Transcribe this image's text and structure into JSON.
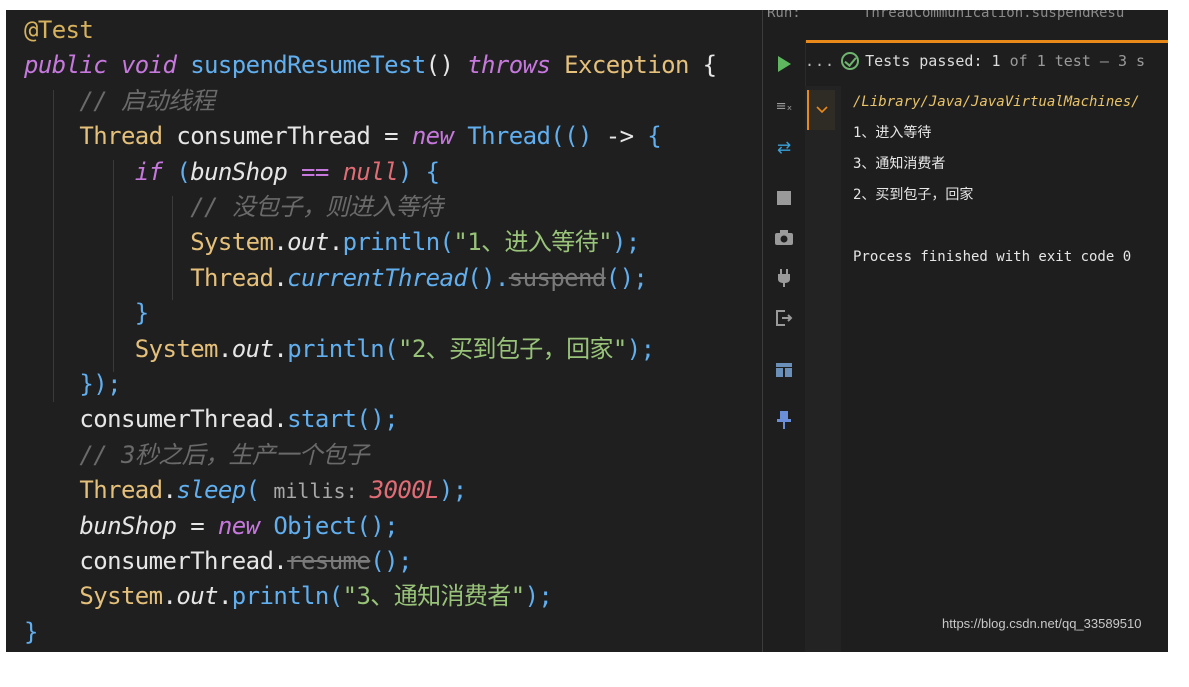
{
  "editor": {
    "lines": [
      [
        {
          "t": "@Test",
          "c": "annot"
        }
      ],
      [
        {
          "t": "public ",
          "c": "kw"
        },
        {
          "t": "void ",
          "c": "kw"
        },
        {
          "t": "suspendResumeTest",
          "c": "fn"
        },
        {
          "t": "() ",
          "c": "plain"
        },
        {
          "t": "throws ",
          "c": "kw"
        },
        {
          "t": "Exception ",
          "c": "cls"
        },
        {
          "t": "{",
          "c": "plain"
        }
      ],
      [
        {
          "t": "    ",
          "c": "plain"
        },
        {
          "t": "// 启动线程",
          "c": "cmt"
        }
      ],
      [
        {
          "t": "    ",
          "c": "plain"
        },
        {
          "t": "Thread ",
          "c": "cls"
        },
        {
          "t": "consumerThread ",
          "c": "plain"
        },
        {
          "t": "= ",
          "c": "plain"
        },
        {
          "t": "new ",
          "c": "kw"
        },
        {
          "t": "Thread",
          "c": "fn"
        },
        {
          "t": "(() ",
          "c": "fn"
        },
        {
          "t": "-> ",
          "c": "plain"
        },
        {
          "t": "{",
          "c": "fn"
        }
      ],
      [
        {
          "t": "        ",
          "c": "plain"
        },
        {
          "t": "if ",
          "c": "kw"
        },
        {
          "t": "(",
          "c": "fn"
        },
        {
          "t": "bunShop ",
          "c": "var"
        },
        {
          "t": "== ",
          "c": "op"
        },
        {
          "t": "null",
          "c": "field"
        },
        {
          "t": ") {",
          "c": "fn"
        }
      ],
      [
        {
          "t": "            ",
          "c": "plain"
        },
        {
          "t": "// 没包子，则进入等待",
          "c": "cmt"
        }
      ],
      [
        {
          "t": "            ",
          "c": "plain"
        },
        {
          "t": "System",
          "c": "cls"
        },
        {
          "t": ".",
          "c": "plain"
        },
        {
          "t": "out",
          "c": "var"
        },
        {
          "t": ".",
          "c": "plain"
        },
        {
          "t": "println",
          "c": "fn"
        },
        {
          "t": "(",
          "c": "fn"
        },
        {
          "t": "\"1、进入等待\"",
          "c": "str"
        },
        {
          "t": ");",
          "c": "fn"
        }
      ],
      [
        {
          "t": "            ",
          "c": "plain"
        },
        {
          "t": "Thread",
          "c": "cls"
        },
        {
          "t": ".",
          "c": "plain"
        },
        {
          "t": "currentThread",
          "c": "ifn"
        },
        {
          "t": "().",
          "c": "fn"
        },
        {
          "t": "suspend",
          "c": "strike"
        },
        {
          "t": "();",
          "c": "fn"
        }
      ],
      [
        {
          "t": "        ",
          "c": "plain"
        },
        {
          "t": "}",
          "c": "fn"
        }
      ],
      [
        {
          "t": "        ",
          "c": "plain"
        },
        {
          "t": "System",
          "c": "cls"
        },
        {
          "t": ".",
          "c": "plain"
        },
        {
          "t": "out",
          "c": "var"
        },
        {
          "t": ".",
          "c": "plain"
        },
        {
          "t": "println",
          "c": "fn"
        },
        {
          "t": "(",
          "c": "fn"
        },
        {
          "t": "\"2、买到包子，回家\"",
          "c": "str"
        },
        {
          "t": ");",
          "c": "fn"
        }
      ],
      [
        {
          "t": "    ",
          "c": "plain"
        },
        {
          "t": "});",
          "c": "fn"
        }
      ],
      [
        {
          "t": "    ",
          "c": "plain"
        },
        {
          "t": "consumerThread",
          "c": "plain"
        },
        {
          "t": ".",
          "c": "plain"
        },
        {
          "t": "start",
          "c": "fn"
        },
        {
          "t": "();",
          "c": "fn"
        }
      ],
      [
        {
          "t": "    ",
          "c": "plain"
        },
        {
          "t": "// 3秒之后，生产一个包子",
          "c": "cmt"
        }
      ],
      [
        {
          "t": "    ",
          "c": "plain"
        },
        {
          "t": "Thread",
          "c": "cls"
        },
        {
          "t": ".",
          "c": "plain"
        },
        {
          "t": "sleep",
          "c": "ifn"
        },
        {
          "t": "( ",
          "c": "fn"
        },
        {
          "t": "millis: ",
          "c": "param"
        },
        {
          "t": "3000L",
          "c": "field"
        },
        {
          "t": ");",
          "c": "fn"
        }
      ],
      [
        {
          "t": "    ",
          "c": "plain"
        },
        {
          "t": "bunShop ",
          "c": "var"
        },
        {
          "t": "= ",
          "c": "plain"
        },
        {
          "t": "new ",
          "c": "kw"
        },
        {
          "t": "Object",
          "c": "fn"
        },
        {
          "t": "();",
          "c": "fn"
        }
      ],
      [
        {
          "t": "    ",
          "c": "plain"
        },
        {
          "t": "consumerThread",
          "c": "plain"
        },
        {
          "t": ".",
          "c": "plain"
        },
        {
          "t": "resume",
          "c": "strike"
        },
        {
          "t": "();",
          "c": "fn"
        }
      ],
      [
        {
          "t": "    ",
          "c": "plain"
        },
        {
          "t": "System",
          "c": "cls"
        },
        {
          "t": ".",
          "c": "plain"
        },
        {
          "t": "out",
          "c": "var"
        },
        {
          "t": ".",
          "c": "plain"
        },
        {
          "t": "println",
          "c": "fn"
        },
        {
          "t": "(",
          "c": "fn"
        },
        {
          "t": "\"3、通知消费者\"",
          "c": "str"
        },
        {
          "t": ");",
          "c": "fn"
        }
      ],
      [
        {
          "t": "}",
          "c": "fn"
        }
      ]
    ]
  },
  "run_panel": {
    "header_label": "Run:",
    "header_tab": "ThreadCommunication.suspendResu",
    "status_dots": "...",
    "status_prefix": "Tests passed: ",
    "status_count": "1",
    "status_of": " of ",
    "status_total": "1 test",
    "status_time": " – 3 s",
    "tools": [
      "run-icon",
      "clear-filter-icon",
      "rerun-icon",
      "stop-icon",
      "camera-icon",
      "plug-icon",
      "exit-icon",
      "layout-icon",
      "pin-icon"
    ],
    "tree_toggle": "chevron-down-icon",
    "output": {
      "path": "/Library/Java/JavaVirtualMachines/",
      "lines": [
        "1、进入等待",
        "3、通知消费者",
        "2、买到包子，回家",
        "",
        "Process finished with exit code 0"
      ]
    }
  },
  "watermark": "https://blog.csdn.net/qq_33589510"
}
